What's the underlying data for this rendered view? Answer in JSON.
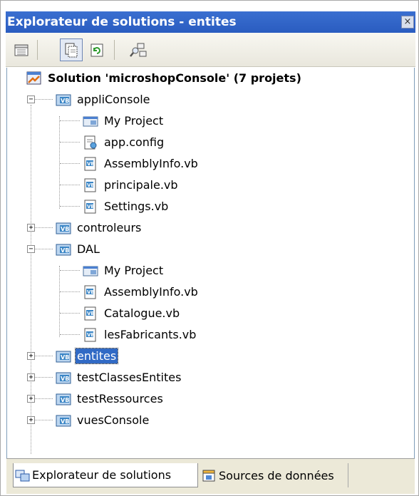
{
  "window": {
    "title": "Explorateur de solutions - entites",
    "close_glyph": "×"
  },
  "toolbar": {
    "buttons": [
      {
        "name": "properties-button",
        "icon": "properties-icon"
      },
      {
        "name": "show-all-files-button",
        "icon": "show-all-files-icon",
        "pressed": true
      },
      {
        "name": "refresh-button",
        "icon": "refresh-icon"
      },
      {
        "name": "view-class-diagram-button",
        "icon": "view-class-diagram-icon"
      }
    ]
  },
  "tree": {
    "solution": "Solution 'microshopConsole' (7 projets)",
    "nodes": [
      {
        "label": "appliConsole",
        "kind": "vb-project",
        "expander": "−"
      },
      {
        "label": "My Project",
        "kind": "my-project"
      },
      {
        "label": "app.config",
        "kind": "config-file"
      },
      {
        "label": "AssemblyInfo.vb",
        "kind": "vb-file"
      },
      {
        "label": "principale.vb",
        "kind": "vb-file"
      },
      {
        "label": "Settings.vb",
        "kind": "vb-file"
      },
      {
        "label": "controleurs",
        "kind": "vb-project",
        "expander": "+"
      },
      {
        "label": "DAL",
        "kind": "vb-project",
        "expander": "−"
      },
      {
        "label": "My Project",
        "kind": "my-project"
      },
      {
        "label": "AssemblyInfo.vb",
        "kind": "vb-file"
      },
      {
        "label": "Catalogue.vb",
        "kind": "vb-file"
      },
      {
        "label": "lesFabricants.vb",
        "kind": "vb-file"
      },
      {
        "label": "entites",
        "kind": "vb-project",
        "expander": "+",
        "selected": true
      },
      {
        "label": "testClassesEntites",
        "kind": "vb-project",
        "expander": "+"
      },
      {
        "label": "testRessources",
        "kind": "vb-project",
        "expander": "+"
      },
      {
        "label": "vuesConsole",
        "kind": "vb-project",
        "expander": "+"
      }
    ]
  },
  "tabs": [
    {
      "label": "Explorateur de solutions",
      "icon": "solution-explorer-icon",
      "active": true
    },
    {
      "label": "Sources de données",
      "icon": "data-sources-icon",
      "active": false
    }
  ],
  "colors": {
    "title_bar": "#2a5cc0",
    "selection": "#316ac5",
    "vb_icon": "#3b86c6"
  }
}
